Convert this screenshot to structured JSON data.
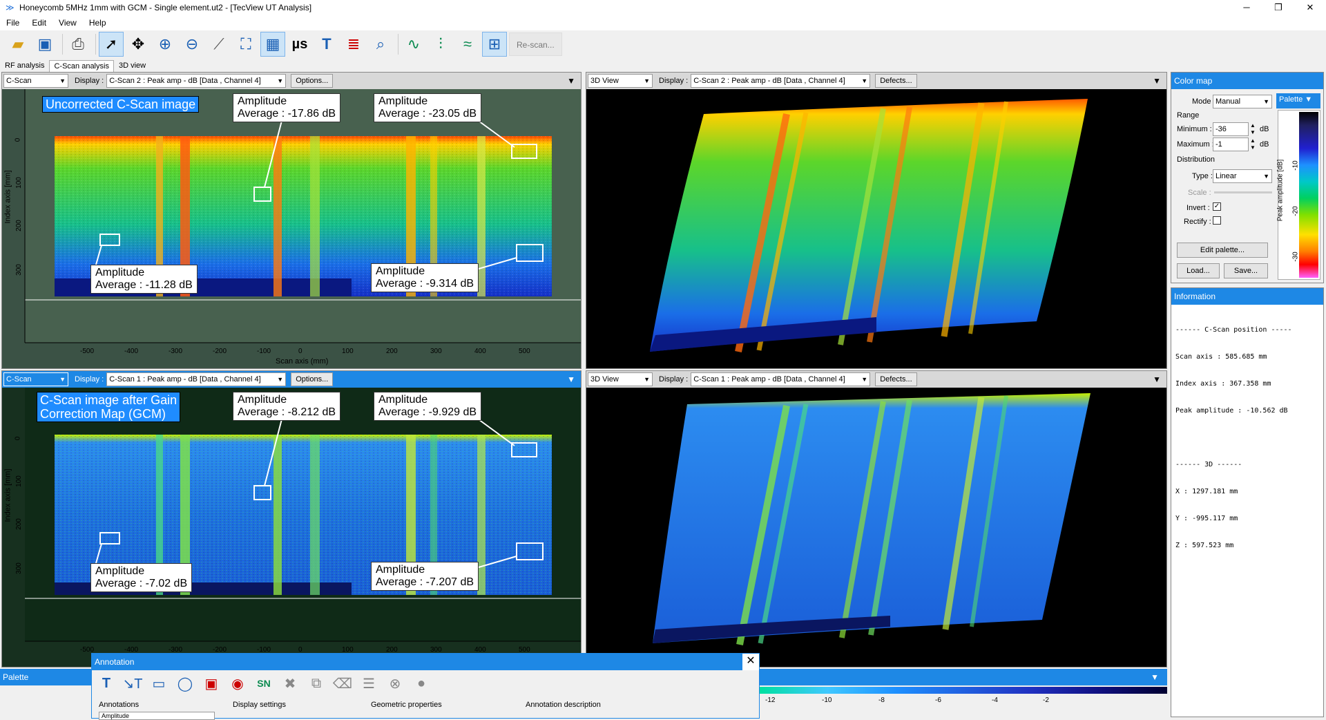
{
  "window": {
    "title": "Honeycomb 5MHz 1mm with GCM - Single element.ut2 - [TecView UT Analysis]",
    "controls": [
      "─",
      "❐",
      "✕"
    ]
  },
  "menu": [
    "File",
    "Edit",
    "View",
    "Help"
  ],
  "toolbar": {
    "rescan": "Re-scan..."
  },
  "tabs": [
    "RF analysis",
    "C-Scan analysis",
    "3D view"
  ],
  "top_left": {
    "view_type": "C-Scan",
    "display_label": "Display :",
    "display_value": "C-Scan 2 : Peak amp - dB [Data , Channel 4]",
    "options": "Options...",
    "title": "Uncorrected C-Scan image",
    "callouts": [
      {
        "line1": "Amplitude",
        "line2": "Average : -17.86 dB"
      },
      {
        "line1": "Amplitude",
        "line2": "Average : -23.05 dB"
      },
      {
        "line1": "Amplitude",
        "line2": "Average : -11.28 dB"
      },
      {
        "line1": "Amplitude",
        "line2": "Average : -9.314 dB"
      }
    ],
    "xlabel": "Scan axis (mm)",
    "ylabel": "Index axis [mm]"
  },
  "bottom_left": {
    "view_type": "C-Scan",
    "display_label": "Display :",
    "display_value": "C-Scan 1 : Peak amp - dB [Data , Channel 4]",
    "options": "Options...",
    "title_line1": "C-Scan image after Gain",
    "title_line2": "Correction Map (GCM)",
    "callouts": [
      {
        "line1": "Amplitude",
        "line2": "Average : -8.212 dB"
      },
      {
        "line1": "Amplitude",
        "line2": "Average : -9.929 dB"
      },
      {
        "line1": "Amplitude",
        "line2": "Average : -7.02 dB"
      },
      {
        "line1": "Amplitude",
        "line2": "Average : -7.207 dB"
      }
    ],
    "ylabel": "Index axis [mm]"
  },
  "x_ticks": [
    "-500",
    "-400",
    "-300",
    "-200",
    "-100",
    "0",
    "100",
    "200",
    "300",
    "400",
    "500"
  ],
  "y_ticks": [
    "0",
    "100",
    "200",
    "300"
  ],
  "top_right": {
    "view_type": "3D View",
    "display_label": "Display :",
    "display_value": "C-Scan 2 : Peak amp - dB [Data , Channel 4]",
    "defects": "Defects..."
  },
  "bottom_right": {
    "view_type": "3D View",
    "display_label": "Display :",
    "display_value": "C-Scan 1 : Peak amp - dB [Data , Channel 4]",
    "defects": "Defects..."
  },
  "color_map": {
    "header": "Color map",
    "mode_label": "Mode :",
    "mode_value": "Manual",
    "range_label": "Range",
    "min_label": "Minimum :",
    "min_value": "-36",
    "max_label": "Maximum :",
    "max_value": "-1",
    "unit": "dB",
    "distribution_label": "Distribution",
    "type_label": "Type :",
    "type_value": "Linear",
    "scale_label": "Scale :",
    "invert_label": "Invert :",
    "rectify_label": "Rectify :",
    "edit_palette": "Edit palette...",
    "load": "Load...",
    "save": "Save...",
    "palette_tab": "Palette",
    "palette_axis": "Peak amplitude [dB]",
    "palette_ticks": [
      "-10",
      "-20",
      "-30"
    ]
  },
  "information": {
    "header": "Information",
    "lines": [
      "------ C-Scan position -----",
      "Scan axis : 585.685 mm",
      "Index axis : 367.358 mm",
      "Peak amplitude : -10.562 dB",
      "",
      "------ 3D ------",
      "X : 1297.181 mm",
      "Y : -995.117 mm",
      "Z : 597.523 mm"
    ]
  },
  "palette_panel": {
    "header": "Palette",
    "ticks": [
      "-12",
      "-10",
      "-8",
      "-6",
      "-4",
      "-2"
    ]
  },
  "annotation": {
    "header": "Annotation",
    "close": "✕",
    "sections": [
      "Annotations",
      "Display settings",
      "Geometric properties",
      "Annotation description"
    ],
    "list_item": "Amplitude"
  }
}
